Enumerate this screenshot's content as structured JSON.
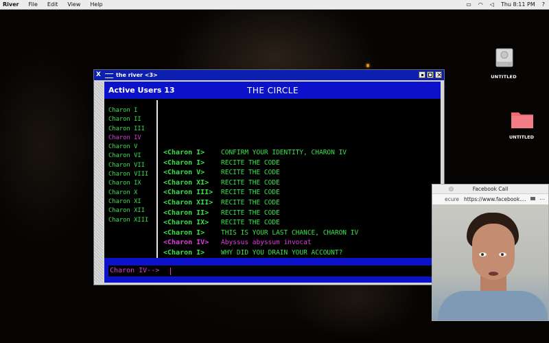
{
  "menubar": {
    "app": "River",
    "items": [
      "File",
      "Edit",
      "View",
      "Help"
    ],
    "clock": "Thu 8:11 PM",
    "help_icon": "?"
  },
  "desktop": {
    "disk_label": "UNTITLED",
    "folder_label": "UNTITLED",
    "folder_color": "#f06a74"
  },
  "window": {
    "title": "the river <3>",
    "active_users": "Active Users 13",
    "channel_title": "THE CIRCLE",
    "users": [
      "Charon I",
      "Charon II",
      "Charon III",
      "Charon IV",
      "Charon V",
      "Charon VI",
      "Charon VII",
      "Charon VIII",
      "Charon IX",
      "Charon X",
      "Charon XI",
      "Charon XII",
      "Charon XIII"
    ],
    "current_user": "Charon IV",
    "messages": [
      {
        "nick": "<Charon I>",
        "text": "CONFIRM YOUR IDENTITY, CHARON IV",
        "me": false
      },
      {
        "nick": "<Charon I>",
        "text": "RECITE THE CODE",
        "me": false
      },
      {
        "nick": "<Charon V>",
        "text": "RECITE THE CODE",
        "me": false
      },
      {
        "nick": "<Charon XI>",
        "text": "RECITE THE CODE",
        "me": false
      },
      {
        "nick": "<Charon III>",
        "text": "RECITE THE CODE",
        "me": false
      },
      {
        "nick": "<Charon XII>",
        "text": "RECITE THE CODE",
        "me": false
      },
      {
        "nick": "<Charon II>",
        "text": "RECITE THE CODE",
        "me": false
      },
      {
        "nick": "<Charon IX>",
        "text": "RECITE THE CODE",
        "me": false
      },
      {
        "nick": "<Charon I>",
        "text": "THIS IS YOUR LAST CHANCE, CHARON IV",
        "me": false
      },
      {
        "nick": "<Charon IV>",
        "text": "Abyssus abyssum invocat",
        "me": true
      },
      {
        "nick": "<Charon I>",
        "text": "WHY DID YOU DRAIN YOUR ACCOUNT?",
        "me": false
      }
    ],
    "prompt": "Charon IV-->",
    "accent_green": "#37e24a",
    "accent_magenta": "#e23adf",
    "bar_blue": "#0c12c9"
  },
  "facebook_call": {
    "title": "Facebook Call",
    "secure": "ecure",
    "url": "https://www.facebook...."
  }
}
